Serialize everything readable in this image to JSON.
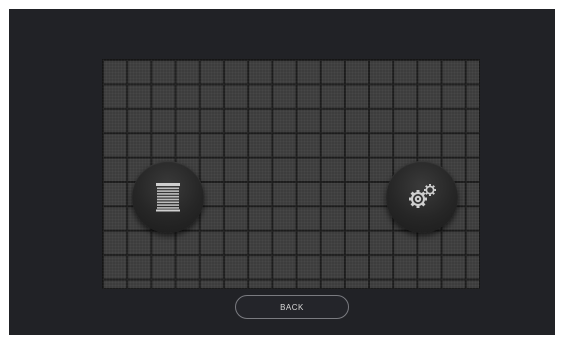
{
  "screen": {
    "background_color": "#212226",
    "grid_color": "#3d3d3d"
  },
  "controls": {
    "blinds": {
      "icon": "window-blinds-icon"
    },
    "settings": {
      "icon": "gears-icon"
    }
  },
  "footer": {
    "back_label": "BACK"
  }
}
